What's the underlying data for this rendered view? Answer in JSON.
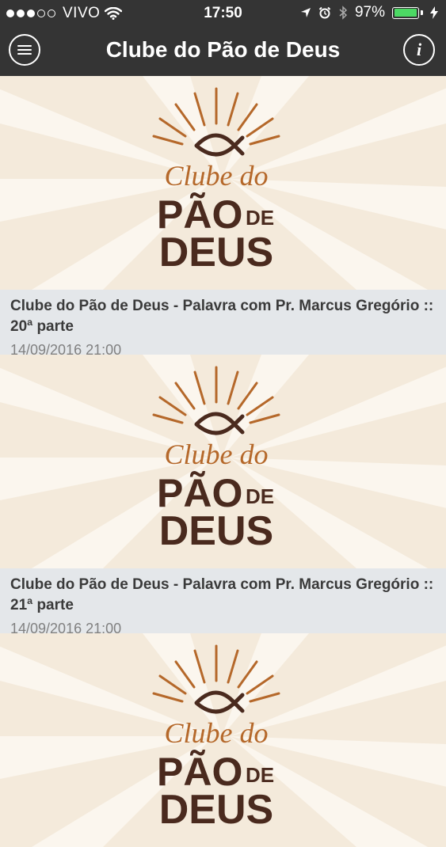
{
  "status_bar": {
    "carrier": "VIVO",
    "time": "17:50",
    "battery": "97%",
    "battery_level": 0.97
  },
  "nav": {
    "title": "Clube do Pão de Deus",
    "menu_icon": "hamburger-menu-icon",
    "info_icon": "info-icon"
  },
  "logo": {
    "line1": "Clube do",
    "line2a": "PÃO",
    "line2b": "DE",
    "line3": "DEUS"
  },
  "colors": {
    "bar": "#343434",
    "brand_brown": "#4a2a1e",
    "brand_orange": "#b5682a",
    "card_info_bg": "#e4e7ea",
    "battery_green": "#4cd964"
  },
  "posts": [
    {
      "title": "Clube do Pão de Deus - Palavra com Pr. Marcus Gregório :: 20ª parte",
      "date": "14/09/2016 21:00"
    },
    {
      "title": "Clube do Pão de Deus - Palavra com Pr. Marcus Gregório :: 21ª parte",
      "date": "14/09/2016 21:00"
    },
    {
      "title": "",
      "date": ""
    }
  ]
}
